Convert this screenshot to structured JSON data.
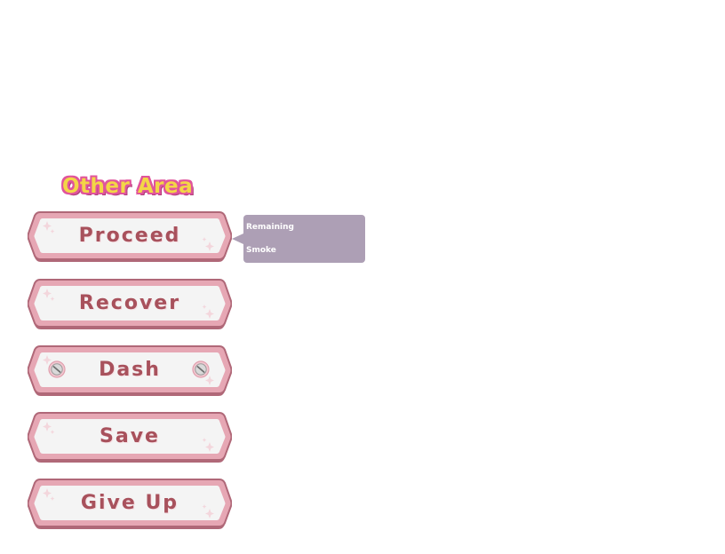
{
  "area_title": "Other Area",
  "commands": [
    {
      "id": "proceed",
      "label": "Proceed"
    },
    {
      "id": "recover",
      "label": "Recover"
    },
    {
      "id": "dash",
      "label": "Dash"
    },
    {
      "id": "save",
      "label": "Save"
    },
    {
      "id": "give-up",
      "label": "Give Up"
    }
  ],
  "tooltip": {
    "line1": "Remaining",
    "line2": "Smoke"
  },
  "colors": {
    "title_fill": "#f3d646",
    "title_outline": "#e0549c",
    "button_text": "#a8515c",
    "button_border": "#b06878",
    "button_inner_border": "#e6a7b4",
    "button_fill": "#f4f4f4",
    "tooltip_bg": "#ad9fb5",
    "tooltip_text": "#ffffff"
  },
  "icons": {
    "dash_left": "circle-slash-icon",
    "dash_right": "circle-slash-icon",
    "sparkle": "sparkle-icon"
  }
}
